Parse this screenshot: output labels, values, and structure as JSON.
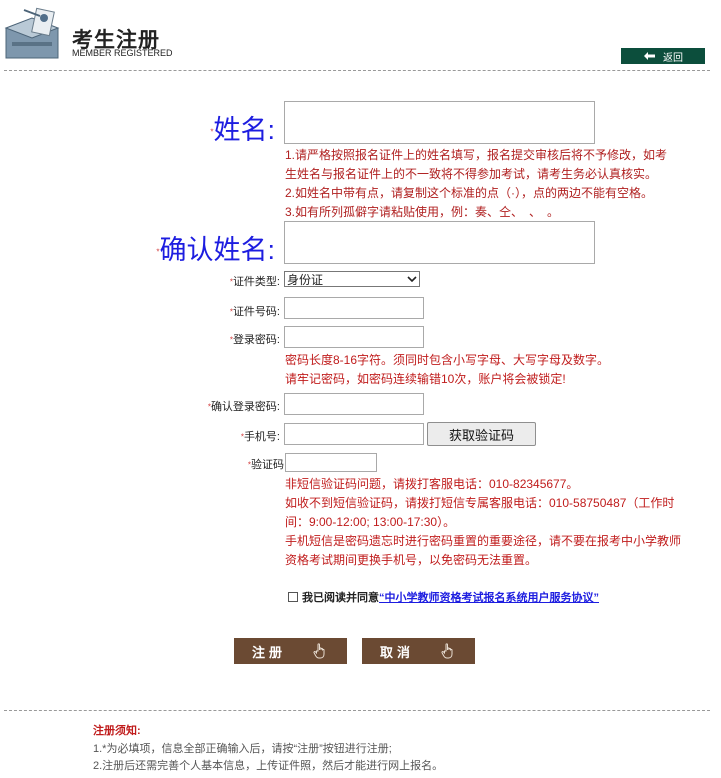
{
  "header": {
    "title": "考生注册",
    "subtitle": "MEMBER REGISTERED",
    "back_label": "返回"
  },
  "form": {
    "name_label": "姓名:",
    "name_notes": [
      "1.请严格按照报名证件上的姓名填写，报名提交审核后将不予修改，如考",
      "生姓名与报名证件上的不一致将不得参加考试，请考生务必认真核实。",
      "2.如姓名中带有点，请复制这个标准的点（·），点的两边不能有空格。",
      "3.如有所列孤僻字请粘贴使用，例：奏、仝、　、　。"
    ],
    "confirm_name_label": "确认姓名:",
    "id_type_label": "证件类型:",
    "id_type_value": "身份证",
    "id_number_label": "证件号码:",
    "password_label": "登录密码:",
    "password_notes": [
      "密码长度8-16字符。须同时包含小写字母、大写字母及数字。",
      "请牢记密码，如密码连续输错10次，账户将会被锁定!"
    ],
    "confirm_password_label": "确认登录密码:",
    "phone_label": "手机号:",
    "get_code_button": "获取验证码",
    "code_label": "验证码",
    "sms_notes": [
      "非短信验证码问题，请拨打客服电话：010-82345677。",
      "如收不到短信验证码，请拨打短信专属客服电话：010-58750487（工作时",
      "间：9:00-12:00; 13:00-17:30）。",
      "手机短信是密码遗忘时进行密码重置的重要途径，请不要在报考中小学教师",
      "资格考试期间更换手机号，以免密码无法重置。"
    ],
    "agree_prefix": "我已阅读并同意",
    "agree_link": "“中小学教师资格考试报名系统用户服务协议”",
    "register_button": "注册",
    "cancel_button": "取消",
    "required_mark": "*"
  },
  "notice": {
    "title": "注册须知:",
    "lines": [
      "1.*为必填项，信息全部正确输入后，请按“注册”按钮进行注册;",
      "2.注册后还需完善个人基本信息，上传证件照，然后才能进行网上报名。"
    ]
  },
  "colors": {
    "back_button_bg": "#0c4e3c",
    "label_blue": "#1d1de0",
    "note_red": "#b02020",
    "button_brown": "#6b4a33"
  }
}
